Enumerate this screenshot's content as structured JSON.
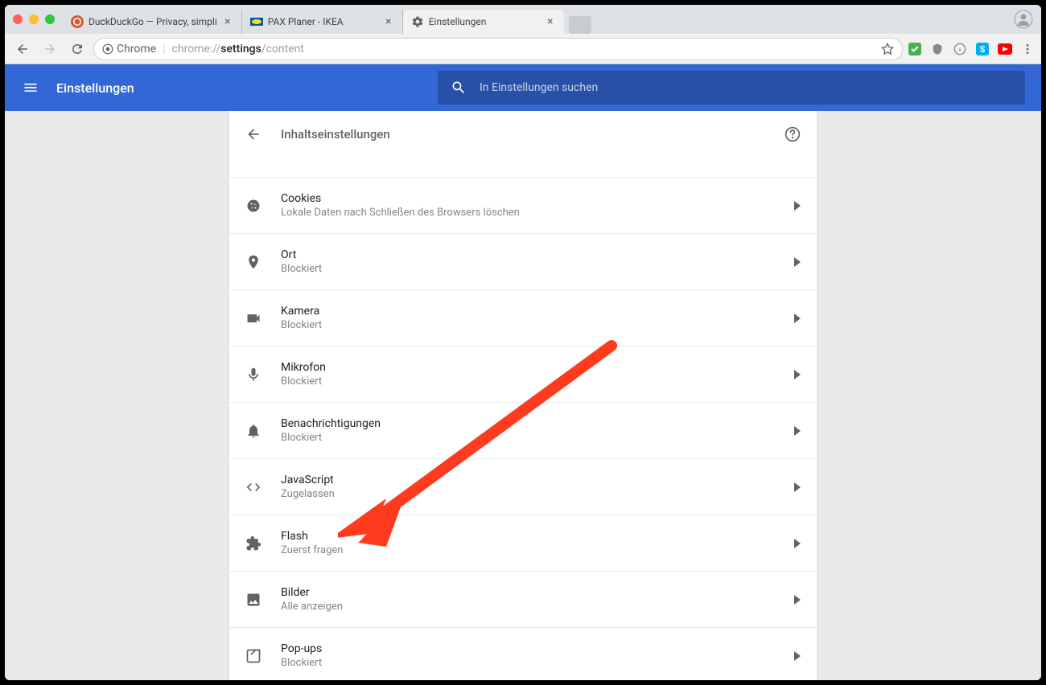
{
  "tabs": [
    {
      "title": "DuckDuckGo — Privacy, simpli",
      "favicon": "duckduckgo"
    },
    {
      "title": "PAX Planer - IKEA",
      "favicon": "ikea"
    },
    {
      "title": "Einstellungen",
      "favicon": "gear",
      "active": true
    }
  ],
  "omnibox": {
    "chip_label": "Chrome",
    "url_prefix": "chrome://",
    "url_bold": "settings",
    "url_suffix": "/content"
  },
  "header": {
    "title": "Einstellungen",
    "search_placeholder": "In Einstellungen suchen"
  },
  "panel": {
    "title": "Inhaltseinstellungen"
  },
  "rows": [
    {
      "icon": "cookie",
      "title": "Cookies",
      "subtitle": "Lokale Daten nach Schließen des Browsers löschen"
    },
    {
      "icon": "location",
      "title": "Ort",
      "subtitle": "Blockiert"
    },
    {
      "icon": "camera",
      "title": "Kamera",
      "subtitle": "Blockiert"
    },
    {
      "icon": "mic",
      "title": "Mikrofon",
      "subtitle": "Blockiert"
    },
    {
      "icon": "bell",
      "title": "Benachrichtigungen",
      "subtitle": "Blockiert"
    },
    {
      "icon": "code",
      "title": "JavaScript",
      "subtitle": "Zugelassen"
    },
    {
      "icon": "puzzle",
      "title": "Flash",
      "subtitle": "Zuerst fragen"
    },
    {
      "icon": "image",
      "title": "Bilder",
      "subtitle": "Alle anzeigen"
    },
    {
      "icon": "popup",
      "title": "Pop-ups",
      "subtitle": "Blockiert"
    }
  ]
}
